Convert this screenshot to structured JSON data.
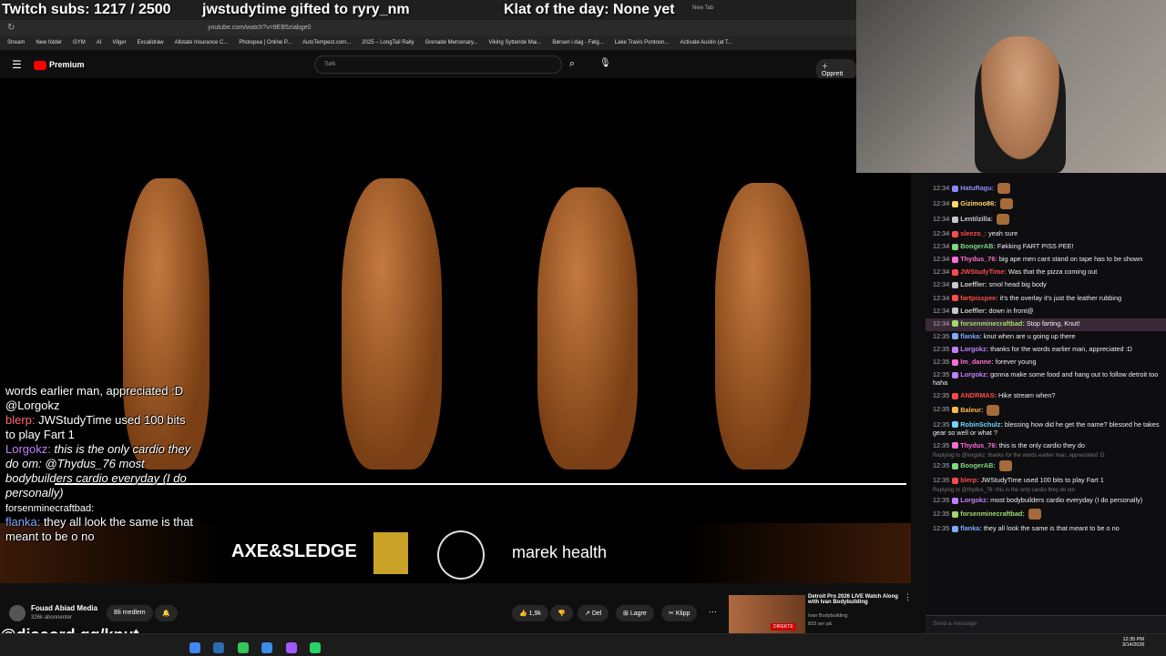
{
  "overlay": {
    "subs": "Twitch subs: 1217 / 2500",
    "gifted": "jwstudytime gifted to ryry_nm",
    "klat": "Klat of the day: None yet",
    "discord": "@discord.gg/knut"
  },
  "browser": {
    "url": "youtube.com/watch?v=9EB5ziabge0",
    "newtab": "New Tab",
    "bookmarks": [
      "Stream",
      "New folder",
      "GYM",
      "AI",
      "Vilger",
      "Excalidraw",
      "Allstate Insurance C...",
      "Photopea | Online P...",
      "AutoTempest.com...",
      "2025 – LongTail Rally",
      "Grenade Mercenary...",
      "Viking Syttende Mai...",
      "Børsen i dag - Følg...",
      "Lake Travis Pontoon...",
      "Activate Austin (at T..."
    ]
  },
  "youtube": {
    "logo": "Premium",
    "search_placeholder": "Søk",
    "create": "Opprett",
    "channel": "Fouad Abiad Media",
    "subscribers": "326k abonnenter",
    "join": "Bli medlem",
    "likes": "1,9k",
    "share": "Del",
    "save": "Lagre",
    "clip": "Klipp",
    "rec_title": "Detroit Pro 2026 LIVE Watch Along with Ivan Bodybuilding",
    "rec_channel": "Ivan Bodybuilding",
    "rec_views": "833 ser på",
    "live": "DIREKTE"
  },
  "sponsors": [
    "AXE&SLEDGE",
    "marek health"
  ],
  "overlay_chat": [
    {
      "user": "",
      "text": "words earlier man, appreciated :D @Lorgokz"
    },
    {
      "user": "blerp:",
      "text": "JWStudyTime used 100 bits to play Fart 1"
    },
    {
      "user": "Lorgokz:",
      "text": "this is the only cardio they do om: @Thydus_76 most bodybuilders cardio everyday (I do personally)"
    },
    {
      "user": "forsenminecraftbad:",
      "text": ""
    },
    {
      "user": "flanka:",
      "text": "they all look the same is that meant to be o no"
    }
  ],
  "chat": [
    {
      "time": "12:34",
      "user": "HatuRagu:",
      "color": "#8a8aff",
      "text": ""
    },
    {
      "time": "12:34",
      "user": "Gizimoo86:",
      "color": "#ffd36b",
      "text": ""
    },
    {
      "time": "12:34",
      "user": "Lentilzilla:",
      "color": "#c8c8c8",
      "text": ""
    },
    {
      "time": "12:34",
      "user": "sleezo_:",
      "color": "#ff4a4a",
      "text": "yeah sure"
    },
    {
      "time": "12:34",
      "user": "BoogerAB:",
      "color": "#7fd87f",
      "text": "Føkking FART PISS PEE!"
    },
    {
      "time": "12:34",
      "user": "Thydus_76:",
      "color": "#ff6bd6",
      "text": "big ape men cant stand on tape has to be shown"
    },
    {
      "time": "12:34",
      "user": "JWStudyTime:",
      "color": "#ff4a4a",
      "text": "Was that the pizza coming out"
    },
    {
      "time": "12:34",
      "user": "Loeffler:",
      "color": "#c8c8c8",
      "text": "smol head big body"
    },
    {
      "time": "12:34",
      "user": "fartpisspee:",
      "color": "#ff4a4a",
      "text": "it's the overlay it's just the leather rubbing"
    },
    {
      "time": "12:34",
      "user": "Loeffler:",
      "color": "#c8c8c8",
      "text": "down in front@"
    },
    {
      "time": "12:34",
      "user": "forsenminecraftbad:",
      "color": "#9fd86b",
      "text": "Stop farting, Knut!"
    },
    {
      "time": "12:35",
      "user": "flanka:",
      "color": "#7fa8ff",
      "text": "knut when are u going up there"
    },
    {
      "time": "12:35",
      "user": "Lorgokz:",
      "color": "#c07fff",
      "text": "thanks for the words earlier man, appreciated :D"
    },
    {
      "time": "12:35",
      "user": "lm_danne:",
      "color": "#ff6bd6",
      "text": "forever young"
    },
    {
      "time": "12:35",
      "user": "Lorgokz:",
      "color": "#c07fff",
      "text": "gonna make some food and hang out to follow detroit too haha"
    },
    {
      "time": "12:35",
      "user": "ANDRMAS:",
      "color": "#ff4a4a",
      "text": "Hike stream when?"
    },
    {
      "time": "12:35",
      "user": "Baleur:",
      "color": "#ffb64a",
      "text": ""
    },
    {
      "time": "12:35",
      "user": "RobinSchulz:",
      "color": "#6bd6ff",
      "text": "blessing how did he get the name? blessed he takes gear so well or what ?"
    },
    {
      "time": "12:35",
      "user": "Thydus_76:",
      "color": "#ff6bd6",
      "text": "this is the only cardio they do"
    },
    {
      "time": "12:35",
      "user": "BoogerAB:",
      "color": "#7fd87f",
      "text": "",
      "reply": "Replying to @lorgokz: thanks for the words earlier man, appreciated :D"
    },
    {
      "time": "12:35",
      "user": "blerp:",
      "color": "#ff4a4a",
      "text": "JWStudyTime used 100 bits to play Fart 1"
    },
    {
      "time": "12:35",
      "user": "Lorgokz:",
      "color": "#c07fff",
      "text": "most bodybuilders cardio everyday (I do personally)",
      "reply": "Replying to @thydus_76: this is the only cardio they do om"
    },
    {
      "time": "12:35",
      "user": "forsenminecraftbad:",
      "color": "#9fd86b",
      "text": ""
    },
    {
      "time": "12:35",
      "user": "flanka:",
      "color": "#7fa8ff",
      "text": "they all look the same is that meant to be o no"
    }
  ],
  "chat_input_placeholder": "Send a message",
  "clock": {
    "time": "12:35 PM",
    "date": "3/14/2026"
  }
}
